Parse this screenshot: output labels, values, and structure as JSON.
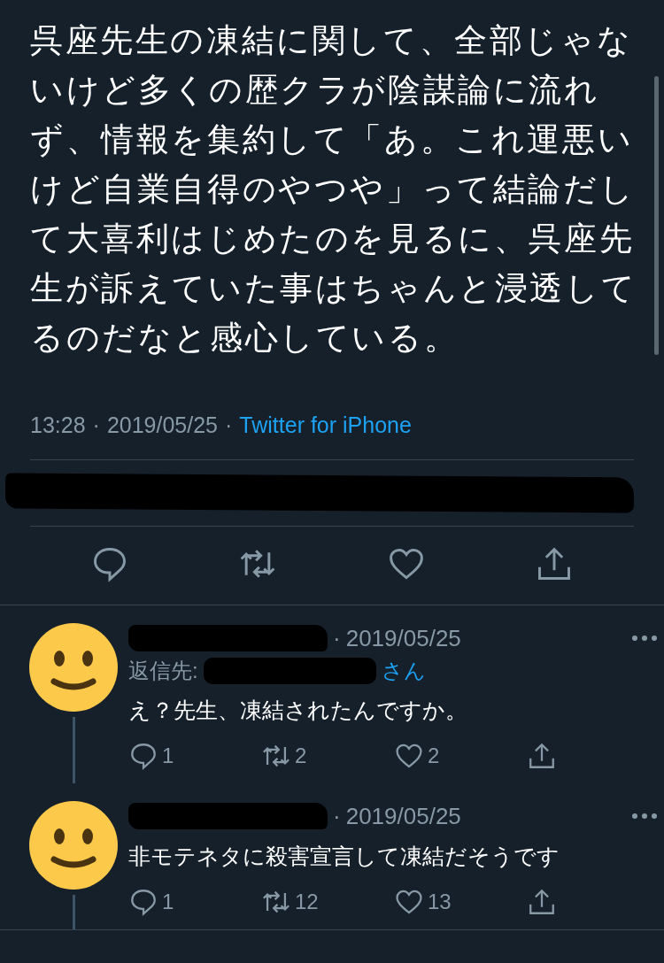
{
  "tweet": {
    "text": "呉座先生の凍結に関して、全部じゃないけど多くの歴クラが陰謀論に流れず、情報を集約して「あ。これ運悪いけど自業自得のやつや」って結論だして大喜利はじめたのを見るに、呉座先生が訴えていた事はちゃんと浸透してるのだなと感心している。",
    "time": "13:28",
    "sep1": "·",
    "date": "2019/05/25",
    "sep2": "·",
    "source": "Twitter for iPhone"
  },
  "replies": [
    {
      "separator": "·",
      "date": "2019/05/25",
      "reply_to": "返信先:",
      "reply_suffix": "さん",
      "text": "え？先生、凍結されたんですか。",
      "replies": "1",
      "retweets": "2",
      "likes": "2"
    },
    {
      "separator": "·",
      "date": "2019/05/25",
      "text": "非モテネタに殺害宣言して凍結だそうです",
      "replies": "1",
      "retweets": "12",
      "likes": "13"
    }
  ]
}
